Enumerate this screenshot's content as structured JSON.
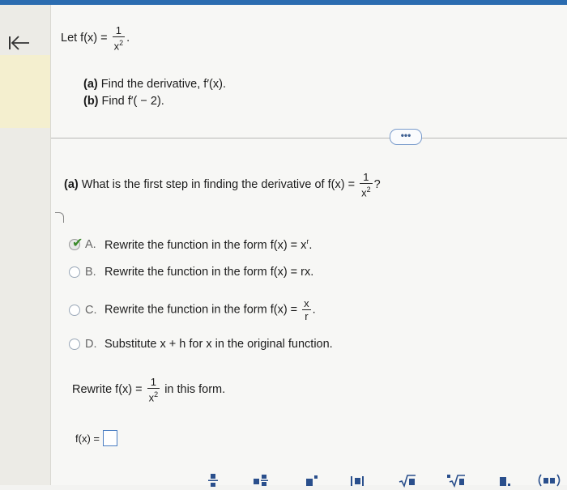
{
  "nav": {
    "back_glyph": "←"
  },
  "problem": {
    "prefix": "Let f(x) =",
    "num": "1",
    "den": "x",
    "den_exp": "2",
    "suffix": ".",
    "part_a_label": "(a)",
    "part_a_text": " Find the derivative, f′(x).",
    "part_b_label": "(b)",
    "part_b_text": " Find f′( − 2)."
  },
  "more_button": {
    "label": "•••"
  },
  "question": {
    "label": "(a)",
    "text": " What is the first step in finding the derivative of f(x) =",
    "num": "1",
    "den": "x",
    "den_exp": "2",
    "suffix": "?"
  },
  "options": [
    {
      "letter": "A.",
      "text": "Rewrite the function in the form f(x) = x",
      "sup": "r",
      "tail": ".",
      "selected": true
    },
    {
      "letter": "B.",
      "text": "Rewrite the function in the form f(x) = rx.",
      "selected": false
    },
    {
      "letter": "C.",
      "text": "Rewrite the function in the form f(x) =",
      "num": "x",
      "den": "r",
      "tail": ".",
      "selected": false
    },
    {
      "letter": "D.",
      "text": "Substitute x + h for x in the original function.",
      "selected": false
    }
  ],
  "rewrite": {
    "prefix": "Rewrite f(x) =",
    "num": "1",
    "den": "x",
    "den_exp": "2",
    "suffix": " in this form."
  },
  "answer": {
    "label": "f(x) ="
  },
  "colors": {
    "accent": "#2b6cb0",
    "check": "#3a8a2a",
    "answer_border": "#4a7dc2"
  }
}
